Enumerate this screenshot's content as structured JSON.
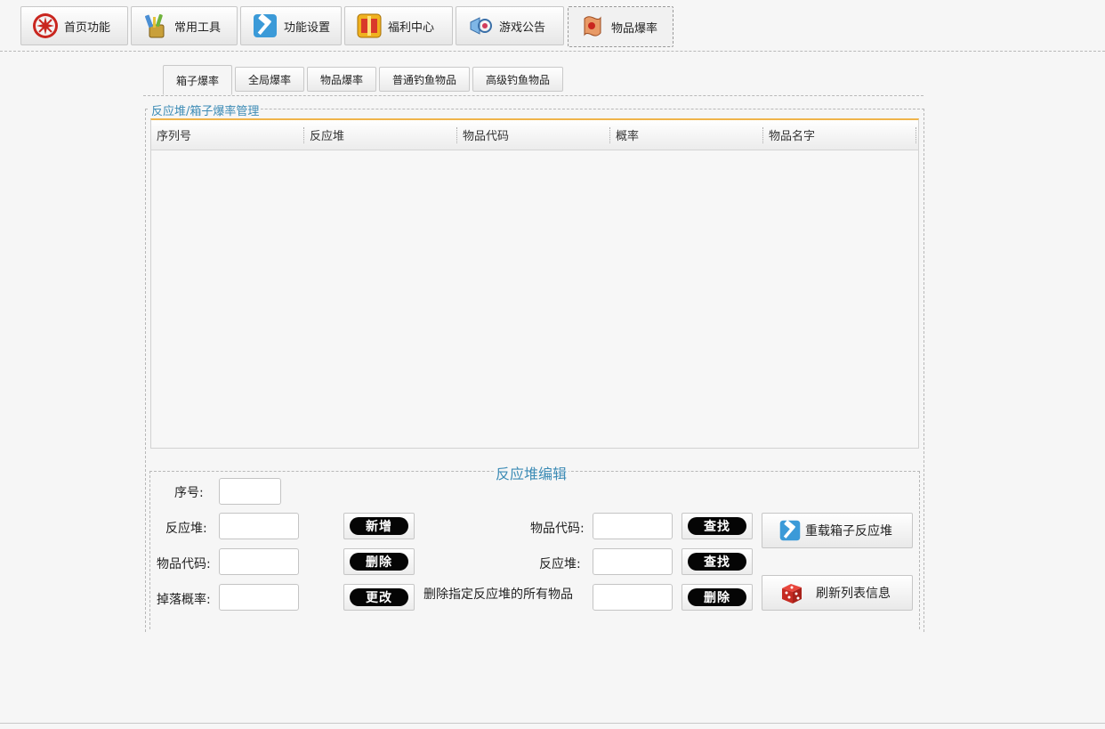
{
  "top_tabs": [
    {
      "label": "首页功能",
      "icon": "home-emblem-icon"
    },
    {
      "label": "常用工具",
      "icon": "toolbox-icon"
    },
    {
      "label": "功能设置",
      "icon": "hammer-icon"
    },
    {
      "label": "福利中心",
      "icon": "gift-icon"
    },
    {
      "label": "游戏公告",
      "icon": "megaphone-icon"
    },
    {
      "label": "物品爆率",
      "icon": "scroll-icon"
    }
  ],
  "sub_tabs": [
    {
      "label": "箱子爆率"
    },
    {
      "label": "全局爆率"
    },
    {
      "label": "物品爆率"
    },
    {
      "label": "普通钓鱼物品"
    },
    {
      "label": "高级钓鱼物品"
    }
  ],
  "group_title": "反应堆/箱子爆率管理",
  "grid": {
    "columns": [
      "序列号",
      "反应堆",
      "物品代码",
      "概率",
      "物品名字"
    ]
  },
  "edit_panel": {
    "title": "反应堆编辑",
    "labels": {
      "serial": "序号:",
      "reactor": "反应堆:",
      "item_code": "物品代码:",
      "drop_rate": "掉落概率:",
      "right_item_code": "物品代码:",
      "right_reactor": "反应堆:",
      "delete_all": "删除指定反应堆的所有物品"
    },
    "buttons": {
      "add": "新增",
      "delete": "删除",
      "update": "更改",
      "find_item": "查找",
      "find_reactor": "查找",
      "delete_all": "删除",
      "reload": "重载箱子反应堆",
      "refresh": "刷新列表信息"
    }
  }
}
